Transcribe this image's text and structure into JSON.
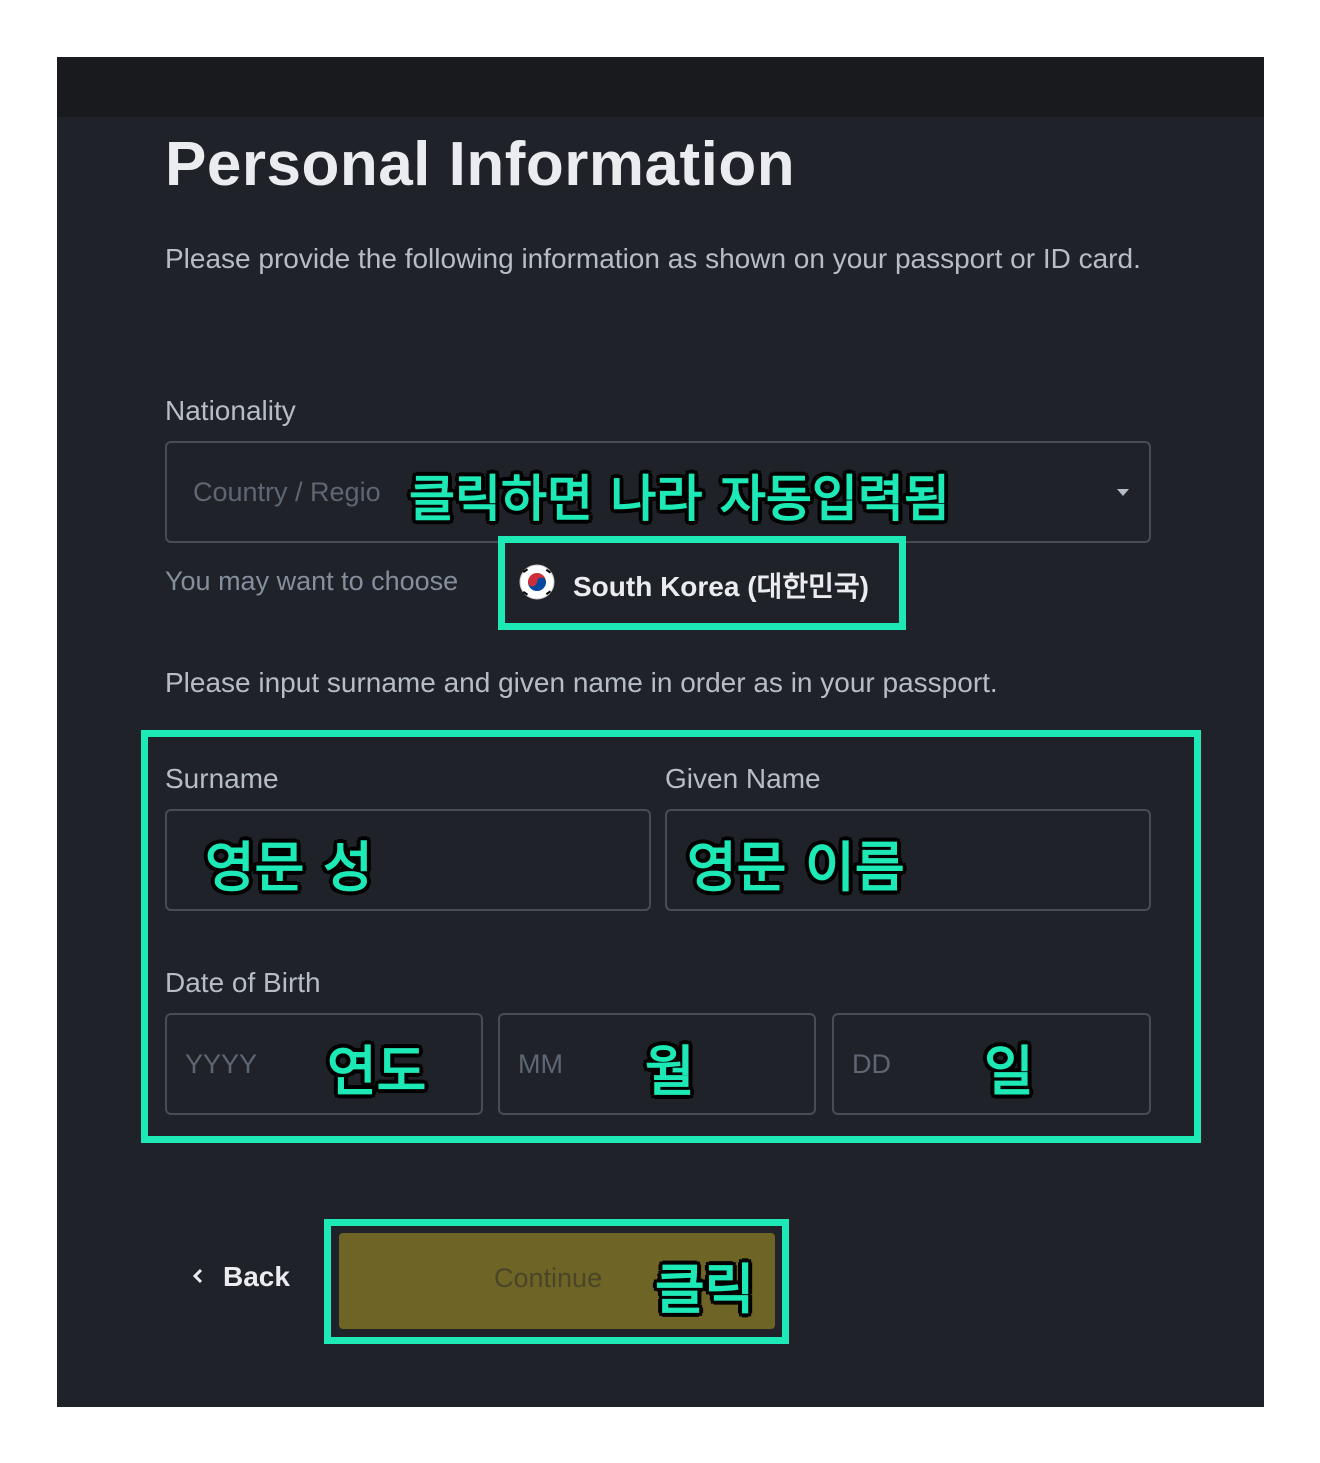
{
  "page": {
    "title": "Personal Information",
    "description": "Please provide the following information as shown on your passport or ID card."
  },
  "nationality": {
    "label": "Nationality",
    "placeholder": "Country / Regio",
    "hint": "You may want to choose",
    "suggestion": "South Korea (대한민국)"
  },
  "name_instruction": "Please input surname and given name in order as in your passport.",
  "surname": {
    "label": "Surname"
  },
  "given_name": {
    "label": "Given Name"
  },
  "dob": {
    "label": "Date of Birth",
    "year_placeholder": "YYYY",
    "month_placeholder": "MM",
    "day_placeholder": "DD"
  },
  "buttons": {
    "back": "Back",
    "continue": "Continue"
  },
  "annotations": {
    "nationality": "클릭하면 나라 자동입력됨",
    "surname": "영문 성",
    "given_name": "영문 이름",
    "year": "연도",
    "month": "월",
    "day": "일",
    "continue": "클릭"
  },
  "colors": {
    "background": "#1f2329",
    "highlight": "#1de9b6",
    "continue_button": "#6e6426"
  }
}
